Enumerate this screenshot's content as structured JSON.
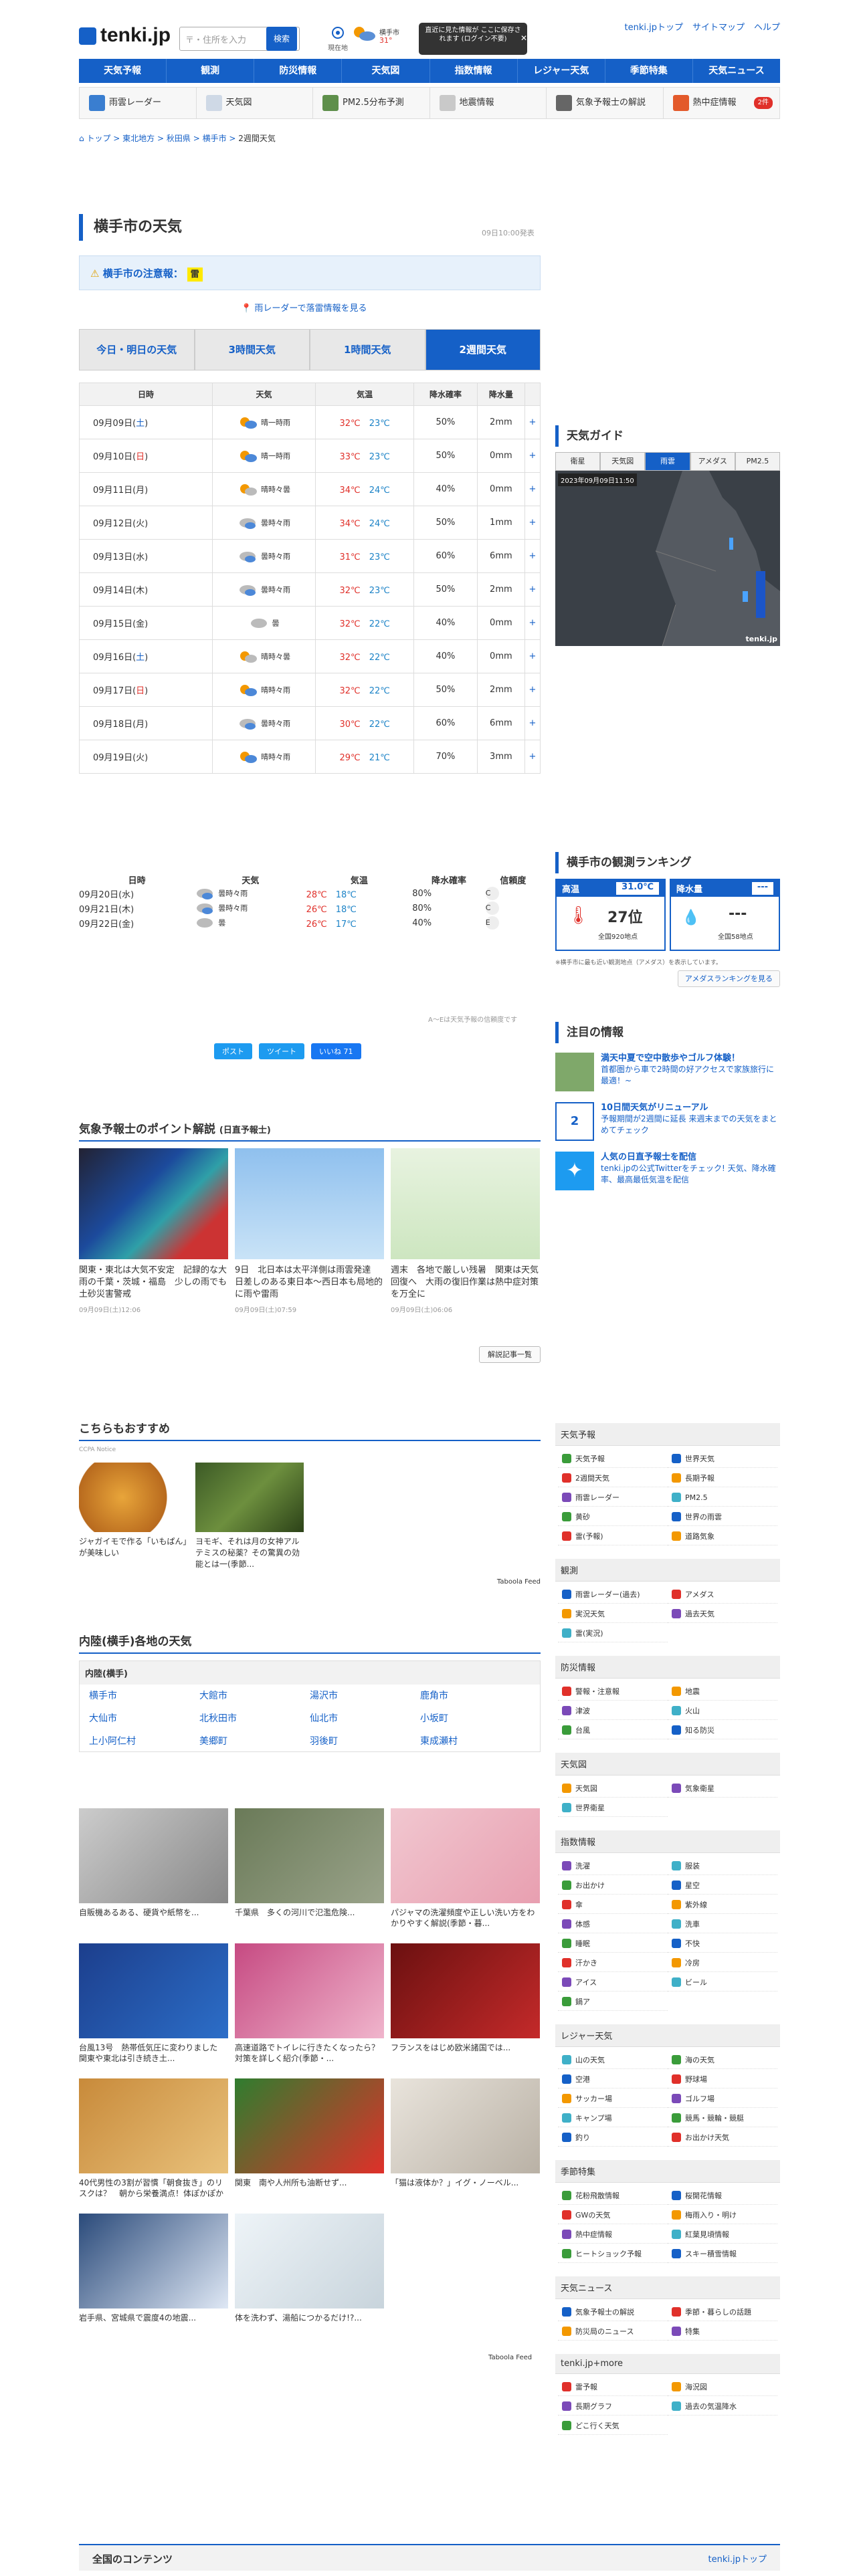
{
  "header": {
    "logo": "tenki.jp",
    "search_placeholder": "〒・住所を入力",
    "search_button": "検索",
    "location_label": "現在地",
    "now_label": "横手市",
    "now_temp": "31°",
    "tooltip": "直近に見た情報が ここに保存されます (ログイン不要)",
    "links": [
      "tenki.jpトップ",
      "サイトマップ",
      "ヘルプ"
    ]
  },
  "nav": [
    "天気予報",
    "観測",
    "防災情報",
    "天気図",
    "指数情報",
    "レジャー天気",
    "季節特集",
    "天気ニュース"
  ],
  "subnav": [
    "雨雲レーダー",
    "天気図",
    "PM2.5分布予測",
    "地震情報",
    "気象予報士の解説",
    "熱中症情報"
  ],
  "subnav_badge": "2件",
  "breadcrumb": {
    "items": [
      "トップ",
      "東北地方",
      "秋田県",
      "横手市"
    ],
    "current": "2週間天気"
  },
  "title": "横手市の天気",
  "announce": "09日10:00発表",
  "warning": {
    "label": "横手市の注意報：",
    "badge": "雷"
  },
  "radar_link": "雨レーダーで落雷情報を見る",
  "tabs": [
    "今日・明日の天気",
    "3時間天気",
    "1時間天気",
    "2週間天気"
  ],
  "forecast": {
    "headers": [
      "日時",
      "天気",
      "気温",
      "降水確率",
      "降水量"
    ],
    "rows": [
      {
        "date": "09月09日(",
        "dow": "土",
        "end": ")",
        "wx": "晴一時雨",
        "hi": "32℃",
        "lo": "23℃",
        "pop": "50%",
        "amt": "2mm"
      },
      {
        "date": "09月10日(",
        "dow": "日",
        "end": ")",
        "wx": "晴一時雨",
        "hi": "33℃",
        "lo": "23℃",
        "pop": "50%",
        "amt": "0mm"
      },
      {
        "date": "09月11日(月)",
        "dow": "",
        "end": "",
        "wx": "晴時々曇",
        "hi": "34℃",
        "lo": "24℃",
        "pop": "40%",
        "amt": "0mm"
      },
      {
        "date": "09月12日(火)",
        "dow": "",
        "end": "",
        "wx": "曇時々雨",
        "hi": "34℃",
        "lo": "24℃",
        "pop": "50%",
        "amt": "1mm"
      },
      {
        "date": "09月13日(水)",
        "dow": "",
        "end": "",
        "wx": "曇時々雨",
        "hi": "31℃",
        "lo": "23℃",
        "pop": "60%",
        "amt": "6mm"
      },
      {
        "date": "09月14日(木)",
        "dow": "",
        "end": "",
        "wx": "曇時々雨",
        "hi": "32℃",
        "lo": "23℃",
        "pop": "50%",
        "amt": "2mm"
      },
      {
        "date": "09月15日(金)",
        "dow": "",
        "end": "",
        "wx": "曇",
        "hi": "32℃",
        "lo": "22℃",
        "pop": "40%",
        "amt": "0mm"
      },
      {
        "date": "09月16日(",
        "dow": "土",
        "end": ")",
        "wx": "晴時々曇",
        "hi": "32℃",
        "lo": "22℃",
        "pop": "40%",
        "amt": "0mm"
      },
      {
        "date": "09月17日(",
        "dow": "日",
        "end": ")",
        "wx": "晴時々雨",
        "hi": "32℃",
        "lo": "22℃",
        "pop": "50%",
        "amt": "2mm"
      },
      {
        "date": "09月18日(月)",
        "dow": "",
        "end": "",
        "wx": "曇時々雨",
        "hi": "30℃",
        "lo": "22℃",
        "pop": "60%",
        "amt": "6mm"
      },
      {
        "date": "09月19日(火)",
        "dow": "",
        "end": "",
        "wx": "晴時々雨",
        "hi": "29℃",
        "lo": "21℃",
        "pop": "70%",
        "amt": "3mm"
      }
    ]
  },
  "forecast2": {
    "headers": [
      "日時",
      "天気",
      "気温",
      "降水確率",
      "信頼度"
    ],
    "rows": [
      {
        "date": "09月20日(水)",
        "wx": "曇時々雨",
        "hi": "28℃",
        "lo": "18℃",
        "pop": "80%",
        "rel": "C"
      },
      {
        "date": "09月21日(木)",
        "wx": "曇時々雨",
        "hi": "26℃",
        "lo": "18℃",
        "pop": "80%",
        "rel": "C"
      },
      {
        "date": "09月22日(金)",
        "wx": "曇",
        "hi": "26℃",
        "lo": "17℃",
        "pop": "40%",
        "rel": "E"
      }
    ],
    "note": "A〜Eは天気予報の信頼度です"
  },
  "share": [
    "ポスト",
    "ツイート",
    "いいね 71"
  ],
  "guide": {
    "title": "天気ガイド",
    "tabs": [
      "衛星",
      "天気図",
      "雨雲",
      "アメダス",
      "PM2.5"
    ],
    "timestamp": "2023年09月09日11:50",
    "brand": "tenki.jp"
  },
  "ranking": {
    "title": "横手市の観測ランキング",
    "high_label": "高温",
    "high_value": "31.0℃",
    "high_rank": "27位",
    "high_sub": "全国920地点",
    "rain_label": "降水量",
    "rain_value": "---",
    "rain_rank": "---",
    "rain_sub": "全国58地点",
    "note": "※横手市に最も近い観測地点（アメダス）を表示しています。",
    "button": "アメダスランキングを見る"
  },
  "notices": {
    "title": "注目の情報",
    "items": [
      {
        "title": "満天中夏で空中散歩やゴルフ体験！",
        "desc": "首都圏から車で2時間の好アクセスで家族旅行に最適！~"
      },
      {
        "title": "10日間天気がリニューアル",
        "desc": "予報期間が2週間に延長 来週末までの天気をまとめてチェック"
      },
      {
        "title": "人気の日直予報士を配信",
        "desc": "tenki.jpの公式Twitterをチェック! 天気、降水確率、最高最低気温を配信"
      }
    ]
  },
  "points": {
    "title": "気象予報士のポイント解説",
    "title_sub": "(日直予報士)",
    "items": [
      {
        "title": "関東・東北は大気不安定　記録的な大雨の千葉・茨城・福島　少しの雨でも土砂災害警戒",
        "date": "09月09日(土)12:06"
      },
      {
        "title": "9日　北日本は太平洋側は雨雲発達　日差しのある東日本〜西日本も局地的に雨や雷雨",
        "date": "09月09日(土)07:59"
      },
      {
        "title": "週末　各地で厳しい残暑　関東は天気回復へ　大雨の復旧作業は熱中症対策を万全に",
        "date": "09月09日(土)06:06"
      }
    ],
    "more": "解説記事一覧"
  },
  "recommend": {
    "title": "こちらもおすすめ",
    "source": "CCPA Notice",
    "items": [
      "ジャガイモで作る「いもぱん」が美味しい",
      "ヨモギ、それは月の女神アルテミスの秘薬？その驚異の効能とは一(季節..."
    ],
    "feed": "Taboola Feed"
  },
  "cities": {
    "title": "内陸(横手)各地の天気",
    "box": "内陸(横手)",
    "list": [
      "横手市",
      "大館市",
      "湯沢市",
      "鹿角市",
      "大仙市",
      "北秋田市",
      "仙北市",
      "小坂町",
      "上小阿仁村",
      "美郷町",
      "羽後町",
      "東成瀬村"
    ]
  },
  "ads": [
    "自販機あるある、硬貨や紙幣を...",
    "千葉県　多くの河川で氾濫危険...",
    "パジャマの洗濯頻度や正しい洗い方をわかりやすく解説(季節・暮...",
    "台風13号　熱帯低気圧に変わりました　関東や東北は引き続き土...",
    "高速道路でトイレに行きたくなったら？対策を詳しく紹介(季節・...",
    "フランスをはじめ欧米諸国では...",
    "40代男性の3割が習慣「朝食抜き」のリスクは？　朝から栄養満点！体ぽかぽか温まる簡単スープレ...",
    "関東　南や人州所も油断せず...",
    "「猫は液体か？」イグ・ノーベル...",
    "岩手県、宮城県で震度4の地震...",
    "体を洗わず、湯船につかるだけ!?..."
  ],
  "ad_feed": "Taboola Feed",
  "rsections": [
    {
      "title": "天気予報",
      "items": [
        "天気予報",
        "世界天気",
        "2週間天気",
        "長期予報",
        "雨雲レーダー",
        "PM2.5",
        "黄砂",
        "世界の雨雲",
        "雷(予報)",
        "道路気象"
      ]
    },
    {
      "title": "観測",
      "items": [
        "雨雲レーダー(過去)",
        "アメダス",
        "実況天気",
        "過去天気",
        "雷(実況)"
      ]
    },
    {
      "title": "防災情報",
      "items": [
        "警報・注意報",
        "地震",
        "津波",
        "火山",
        "台風",
        "知る防災"
      ]
    },
    {
      "title": "天気図",
      "items": [
        "天気図",
        "気象衛星",
        "世界衛星"
      ]
    },
    {
      "title": "指数情報",
      "items": [
        "洗濯",
        "服装",
        "お出かけ",
        "星空",
        "傘",
        "紫外線",
        "体感",
        "洗車",
        "睡眠",
        "不快",
        "汗かき",
        "冷房",
        "アイス",
        "ビール",
        "鍋ア"
      ]
    },
    {
      "title": "レジャー天気",
      "items": [
        "山の天気",
        "海の天気",
        "空港",
        "野球場",
        "サッカー場",
        "ゴルフ場",
        "キャンプ場",
        "競馬・競輪・競艇",
        "釣り",
        "お出かけ天気"
      ]
    },
    {
      "title": "季節特集",
      "items": [
        "花粉飛散情報",
        "桜開花情報",
        "GWの天気",
        "梅雨入り・明け",
        "熱中症情報",
        "紅葉見頃情報",
        "ヒートショック予報",
        "スキー積雪情報"
      ]
    },
    {
      "title": "天気ニュース",
      "items": [
        "気象予報士の解説",
        "季節・暮らしの話題",
        "防災局のニュース",
        "特集"
      ]
    },
    {
      "title": "tenki.jp+more",
      "items": [
        "雷予報",
        "海況図",
        "長期グラフ",
        "過去の気温降水",
        "どこ行く天気"
      ]
    }
  ],
  "footer": {
    "label": "全国のコンテンツ",
    "top": "tenki.jpトップ"
  },
  "colors": {
    "brand": "#1560c7",
    "high": "#e0302a",
    "low": "#1c83c7"
  }
}
